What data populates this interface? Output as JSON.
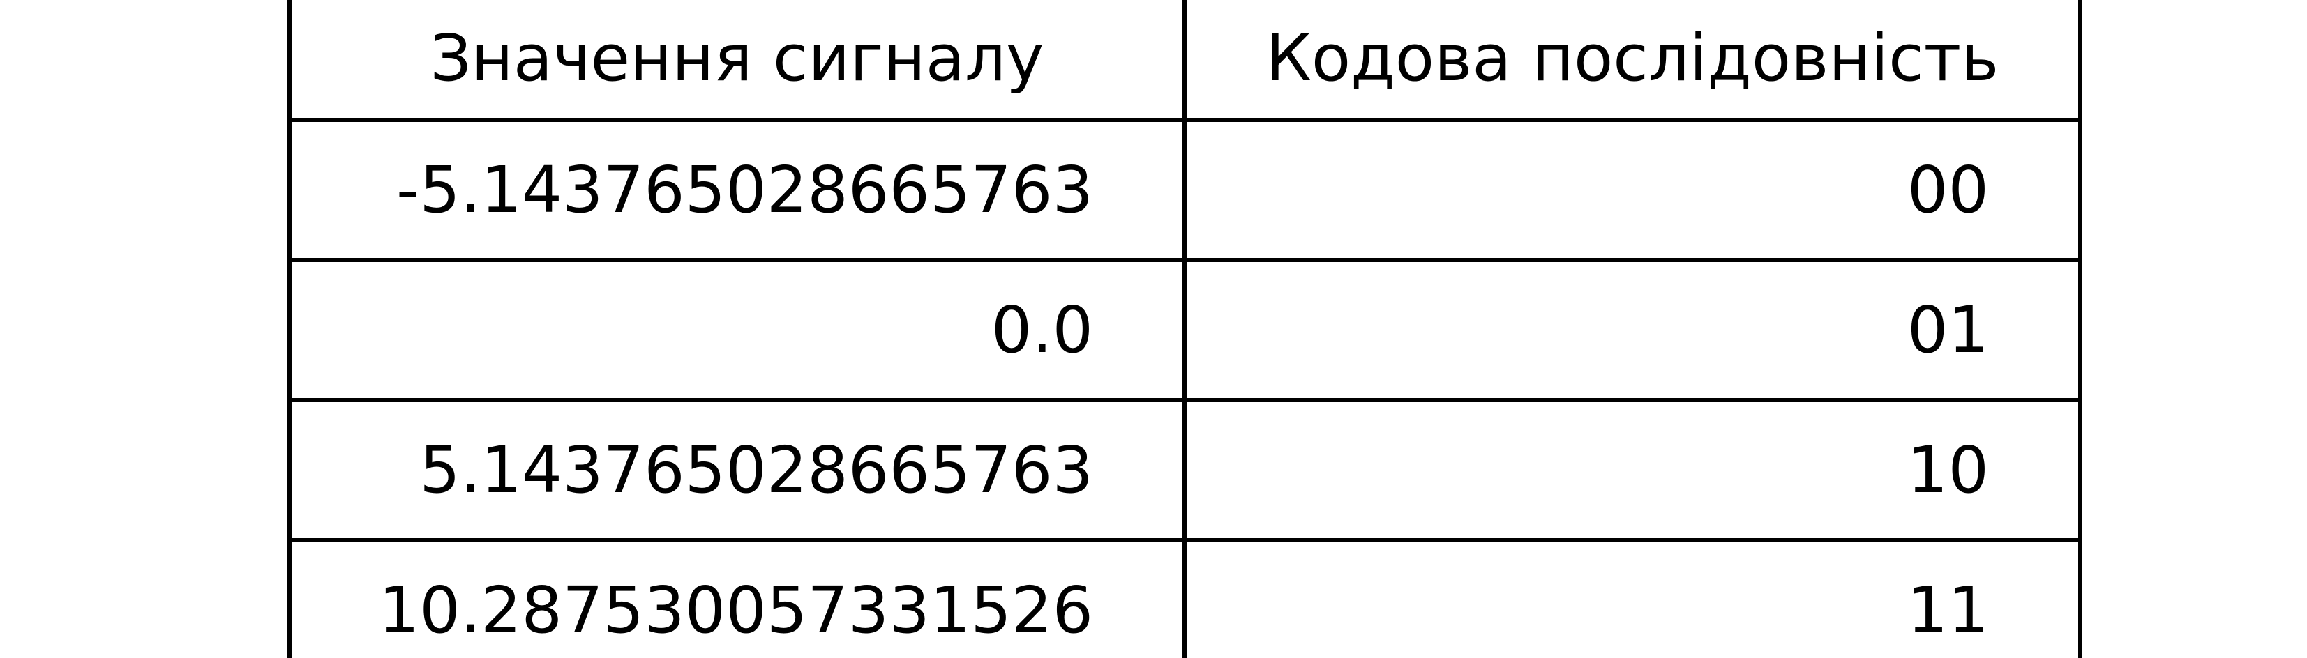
{
  "chart_data": {
    "type": "table",
    "columns": [
      "Значення сигналу",
      "Кодова послідовність"
    ],
    "rows": [
      {
        "signal": "-5.143765028665763",
        "code": "00"
      },
      {
        "signal": "0.0",
        "code": "01"
      },
      {
        "signal": "5.143765028665763",
        "code": "10"
      },
      {
        "signal": "10.287530057331526",
        "code": "11"
      }
    ],
    "colors": {
      "border": "#000000",
      "text": "#000000",
      "background": "#ffffff"
    }
  }
}
